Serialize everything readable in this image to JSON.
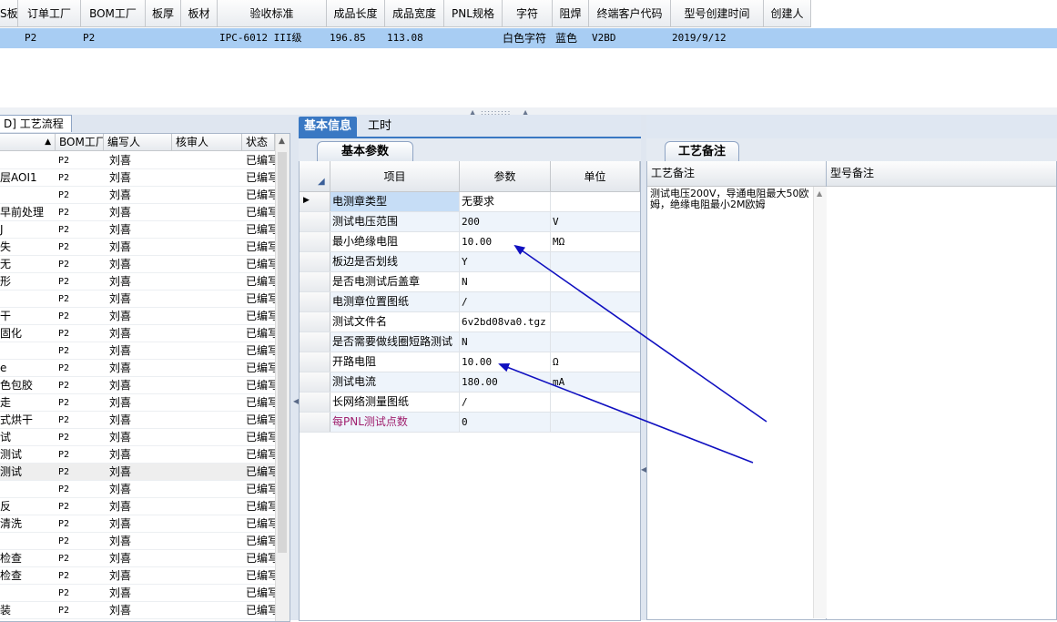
{
  "top_grid": {
    "columns": [
      "S板",
      "订单工厂",
      "BOM工厂",
      "板厚",
      "板材",
      "验收标准",
      "成品长度",
      "成品宽度",
      "PNL规格",
      "字符",
      "阻焊",
      "终端客户代码",
      "型号创建时间",
      "创建人"
    ],
    "row": {
      "order_factory": "P2",
      "bom_factory": "P2",
      "acceptance": "IPC-6012 III级",
      "length": "196.85",
      "width": "113.08",
      "silkscreen": "白色字符",
      "solder_mask": "蓝色",
      "customer_code": "V2BD",
      "created": "2019/9/12"
    }
  },
  "left_panel": {
    "tab_label": "D] 工艺流程",
    "columns": [
      "",
      "BOM工厂",
      "编写人",
      "核审人",
      "状态"
    ],
    "rows": [
      {
        "name": "",
        "factory": "P2",
        "writer": "刘喜",
        "status": "已编写"
      },
      {
        "name": "层AOI1",
        "factory": "P2",
        "writer": "刘喜",
        "status": "已编写"
      },
      {
        "name": "",
        "factory": "P2",
        "writer": "刘喜",
        "status": "已编写"
      },
      {
        "name": "早前处理",
        "factory": "P2",
        "writer": "刘喜",
        "status": "已编写"
      },
      {
        "name": "J",
        "factory": "P2",
        "writer": "刘喜",
        "status": "已编写"
      },
      {
        "name": "失",
        "factory": "P2",
        "writer": "刘喜",
        "status": "已编写"
      },
      {
        "name": "无",
        "factory": "P2",
        "writer": "刘喜",
        "status": "已编写"
      },
      {
        "name": "形",
        "factory": "P2",
        "writer": "刘喜",
        "status": "已编写"
      },
      {
        "name": "",
        "factory": "P2",
        "writer": "刘喜",
        "status": "已编写"
      },
      {
        "name": "干",
        "factory": "P2",
        "writer": "刘喜",
        "status": "已编写"
      },
      {
        "name": "固化",
        "factory": "P2",
        "writer": "刘喜",
        "status": "已编写"
      },
      {
        "name": "",
        "factory": "P2",
        "writer": "刘喜",
        "status": "已编写"
      },
      {
        "name": "e",
        "factory": "P2",
        "writer": "刘喜",
        "status": "已编写"
      },
      {
        "name": "色包胶",
        "factory": "P2",
        "writer": "刘喜",
        "status": "已编写"
      },
      {
        "name": "走",
        "factory": "P2",
        "writer": "刘喜",
        "status": "已编写"
      },
      {
        "name": "式烘干",
        "factory": "P2",
        "writer": "刘喜",
        "status": "已编写"
      },
      {
        "name": "试",
        "factory": "P2",
        "writer": "刘喜",
        "status": "已编写"
      },
      {
        "name": "测试",
        "factory": "P2",
        "writer": "刘喜",
        "status": "已编写"
      },
      {
        "name": "测试",
        "factory": "P2",
        "writer": "刘喜",
        "status": "已编写"
      },
      {
        "name": "",
        "factory": "P2",
        "writer": "刘喜",
        "status": "已编写"
      },
      {
        "name": "反",
        "factory": "P2",
        "writer": "刘喜",
        "status": "已编写"
      },
      {
        "name": "清洗",
        "factory": "P2",
        "writer": "刘喜",
        "status": "已编写"
      },
      {
        "name": "",
        "factory": "P2",
        "writer": "刘喜",
        "status": "已编写"
      },
      {
        "name": "检查",
        "factory": "P2",
        "writer": "刘喜",
        "status": "已编写"
      },
      {
        "name": "检查",
        "factory": "P2",
        "writer": "刘喜",
        "status": "已编写"
      },
      {
        "name": "",
        "factory": "P2",
        "writer": "刘喜",
        "status": "已编写"
      },
      {
        "name": "装",
        "factory": "P2",
        "writer": "刘喜",
        "status": "已编写"
      }
    ]
  },
  "mid_panel": {
    "tabs": [
      "基本信息",
      "工时"
    ],
    "sub_tab": "基本参数",
    "columns": [
      "项目",
      "参数",
      "单位"
    ],
    "rows": [
      {
        "name": "电测章类型",
        "value": "无要求",
        "unit": ""
      },
      {
        "name": "测试电压范围",
        "value": "200",
        "unit": "V"
      },
      {
        "name": "最小绝缘电阻",
        "value": "10.00",
        "unit": "MΩ"
      },
      {
        "name": "板边是否划线",
        "value": "Y",
        "unit": ""
      },
      {
        "name": "是否电测试后盖章",
        "value": "N",
        "unit": ""
      },
      {
        "name": "电测章位置图纸",
        "value": "/",
        "unit": ""
      },
      {
        "name": "测试文件名",
        "value": "6v2bd08va0.tgz",
        "unit": ""
      },
      {
        "name": "是否需要做线圈短路测试",
        "value": "N",
        "unit": ""
      },
      {
        "name": "开路电阻",
        "value": "10.00",
        "unit": "Ω"
      },
      {
        "name": "测试电流",
        "value": "180.00",
        "unit": "mA"
      },
      {
        "name": "长网络测量图纸",
        "value": "/",
        "unit": ""
      },
      {
        "name": "每PNL测试点数",
        "value": "0",
        "unit": ""
      }
    ]
  },
  "right_panel": {
    "tab_label": "工艺备注",
    "remark_header": "工艺备注",
    "model_header": "型号备注",
    "remark_text": "测试电压200V，导通电阻最大50欧姆，绝缘电阻最小2M欧姆"
  },
  "colors": {
    "selection_blue": "#a8cdf3",
    "tab_blue": "#3a78c3",
    "annotation_arrow": "#1010c0",
    "purple_label": "#a0206e"
  }
}
